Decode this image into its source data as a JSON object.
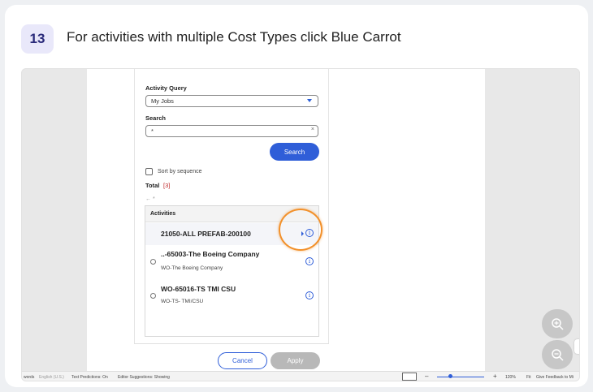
{
  "step": {
    "number": "13",
    "title": "For activities with multiple Cost Types click Blue Carrot"
  },
  "form": {
    "activity_query_label": "Activity Query",
    "activity_query_value": "My Jobs",
    "search_label": "Search",
    "search_value": "*",
    "clear_glyph": "×",
    "search_button": "Search",
    "sort_label": "Sort by sequence",
    "total_label": "Total",
    "total_count": "[3]",
    "back_glyph": "← *"
  },
  "activities": {
    "header": "Activities",
    "items": [
      {
        "title": "21050-ALL PREFAB-200100",
        "subtitle": ""
      },
      {
        "title": "..-65003-The Boeing Company",
        "subtitle": "WO-The Boeing Company"
      },
      {
        "title": "WO-65016-TS TMI CSU",
        "subtitle": "WO-TS- TMI/CSU"
      }
    ]
  },
  "footer": {
    "cancel": "Cancel",
    "apply": "Apply"
  },
  "statusbar": {
    "words": "words",
    "language": "English (U.S.)",
    "text_predictions": "Text Predictions: On",
    "editor": "Editor Suggestions: Showing",
    "zoom": "120%",
    "fit": "Fit",
    "feedback": "Give Feedback to Mi"
  },
  "colors": {
    "accent": "#2f5ed8",
    "highlight": "#f2902a",
    "total_count": "#c0282a"
  }
}
